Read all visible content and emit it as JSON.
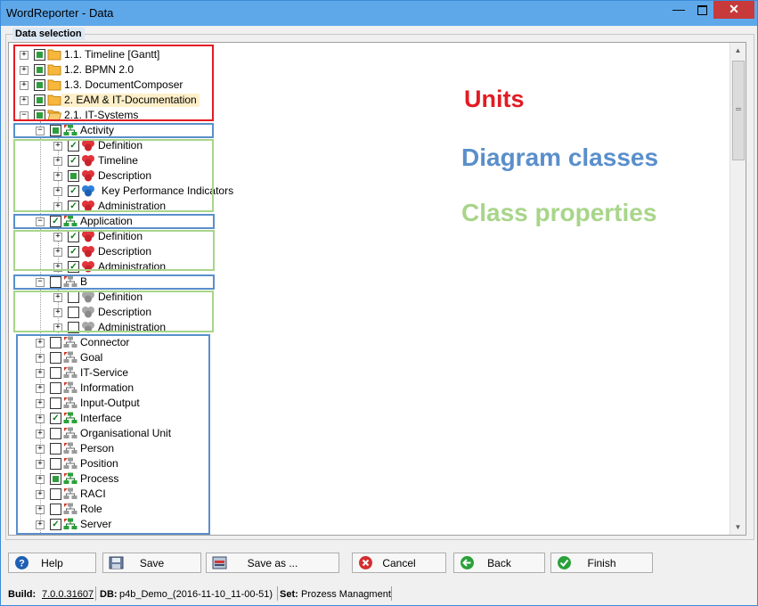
{
  "window": {
    "title": "WordReporter - Data"
  },
  "groupbox": {
    "label": "Data selection"
  },
  "tree": [
    {
      "label": "1.1. Timeline [Gantt]",
      "icon": "folder-icon",
      "check": "partial",
      "expander": "+",
      "level": 0
    },
    {
      "label": "1.2. BPMN 2.0",
      "icon": "folder-icon",
      "check": "partial",
      "expander": "+",
      "level": 0
    },
    {
      "label": "1.3. DocumentComposer",
      "icon": "folder-icon",
      "check": "partial",
      "expander": "+",
      "level": 0
    },
    {
      "label": "2. EAM & IT-Documentation",
      "icon": "folder-icon",
      "check": "partial",
      "expander": "+",
      "level": 0,
      "selected": true
    },
    {
      "label": "2.1. IT-Systems",
      "icon": "folder-open-icon",
      "check": "partial",
      "expander": "-",
      "level": 0
    },
    {
      "label": "Activity",
      "icon": "diagram-class-icon",
      "check": "partial",
      "expander": "-",
      "level": 1
    },
    {
      "label": "Definition",
      "icon": "property-red-icon",
      "check": "checked",
      "expander": "+",
      "level": 2
    },
    {
      "label": "Timeline",
      "icon": "property-red-icon",
      "check": "checked",
      "expander": "+",
      "level": 2
    },
    {
      "label": "Description",
      "icon": "property-red-icon",
      "check": "partial",
      "expander": "+",
      "level": 2
    },
    {
      "label": "Key Performance Indicators",
      "icon": "property-blue-icon",
      "check": "checked",
      "expander": "+",
      "level": 2
    },
    {
      "label": "Administration",
      "icon": "property-red-icon",
      "check": "checked",
      "expander": "+",
      "level": 2
    },
    {
      "label": "Application",
      "icon": "diagram-class-icon",
      "check": "checked",
      "expander": "-",
      "level": 1
    },
    {
      "label": "Definition",
      "icon": "property-red-icon",
      "check": "checked",
      "expander": "+",
      "level": 2
    },
    {
      "label": "Description",
      "icon": "property-red-icon",
      "check": "checked",
      "expander": "+",
      "level": 2
    },
    {
      "label": "Administration",
      "icon": "property-red-icon",
      "check": "checked",
      "expander": "+",
      "level": 2
    },
    {
      "label": "B",
      "icon": "diagram-class-gray-icon",
      "check": "unchecked",
      "expander": "-",
      "level": 1
    },
    {
      "label": "Definition",
      "icon": "property-gray-icon",
      "check": "unchecked",
      "expander": "+",
      "level": 2
    },
    {
      "label": "Description",
      "icon": "property-gray-icon",
      "check": "unchecked",
      "expander": "+",
      "level": 2
    },
    {
      "label": "Administration",
      "icon": "property-gray-icon",
      "check": "unchecked",
      "expander": "+",
      "level": 2
    },
    {
      "label": "Connector",
      "icon": "diagram-class-gray-icon",
      "check": "unchecked",
      "expander": "+",
      "level": 1
    },
    {
      "label": "Goal",
      "icon": "diagram-class-gray-icon",
      "check": "unchecked",
      "expander": "+",
      "level": 1
    },
    {
      "label": "IT-Service",
      "icon": "diagram-class-gray-icon",
      "check": "unchecked",
      "expander": "+",
      "level": 1
    },
    {
      "label": "Information",
      "icon": "diagram-class-gray-icon",
      "check": "unchecked",
      "expander": "+",
      "level": 1
    },
    {
      "label": "Input-Output",
      "icon": "diagram-class-gray-icon",
      "check": "unchecked",
      "expander": "+",
      "level": 1
    },
    {
      "label": "Interface",
      "icon": "diagram-class-icon",
      "check": "checked",
      "expander": "+",
      "level": 1
    },
    {
      "label": "Organisational Unit",
      "icon": "diagram-class-gray-icon",
      "check": "unchecked",
      "expander": "+",
      "level": 1
    },
    {
      "label": "Person",
      "icon": "diagram-class-gray-icon",
      "check": "unchecked",
      "expander": "+",
      "level": 1
    },
    {
      "label": "Position",
      "icon": "diagram-class-gray-icon",
      "check": "unchecked",
      "expander": "+",
      "level": 1
    },
    {
      "label": "Process",
      "icon": "diagram-class-icon",
      "check": "partial",
      "expander": "+",
      "level": 1
    },
    {
      "label": "RACI",
      "icon": "diagram-class-gray-icon",
      "check": "unchecked",
      "expander": "+",
      "level": 1
    },
    {
      "label": "Role",
      "icon": "diagram-class-gray-icon",
      "check": "unchecked",
      "expander": "+",
      "level": 1
    },
    {
      "label": "Server",
      "icon": "diagram-class-icon",
      "check": "checked",
      "expander": "+",
      "level": 1
    }
  ],
  "legend": {
    "units": {
      "text": "Units",
      "color": "#e31b23"
    },
    "diagram_classes": {
      "text": "Diagram classes",
      "color": "#5a8fcb"
    },
    "class_properties": {
      "text": "Class properties",
      "color": "#a8d58a"
    }
  },
  "buttons": {
    "help": {
      "label": "Help",
      "icon": "help-icon"
    },
    "save": {
      "label": "Save",
      "icon": "save-icon"
    },
    "save_as": {
      "label": "Save as ...",
      "icon": "save-as-icon"
    },
    "cancel": {
      "label": "Cancel",
      "icon": "cancel-icon"
    },
    "back": {
      "label": "Back",
      "icon": "back-icon"
    },
    "finish": {
      "label": "Finish",
      "icon": "finish-icon"
    }
  },
  "status": {
    "build_label": "Build:",
    "build_value": "7.0.0.31607",
    "db_label": "DB:",
    "db_value": "p4b_Demo_(2016-11-10_11-00-51)",
    "set_label": "Set:",
    "set_value": "Prozess Managment"
  },
  "colors": {
    "titlebar": "#5ea8ea",
    "close": "#c7393a",
    "selection": "#fff0c9"
  }
}
